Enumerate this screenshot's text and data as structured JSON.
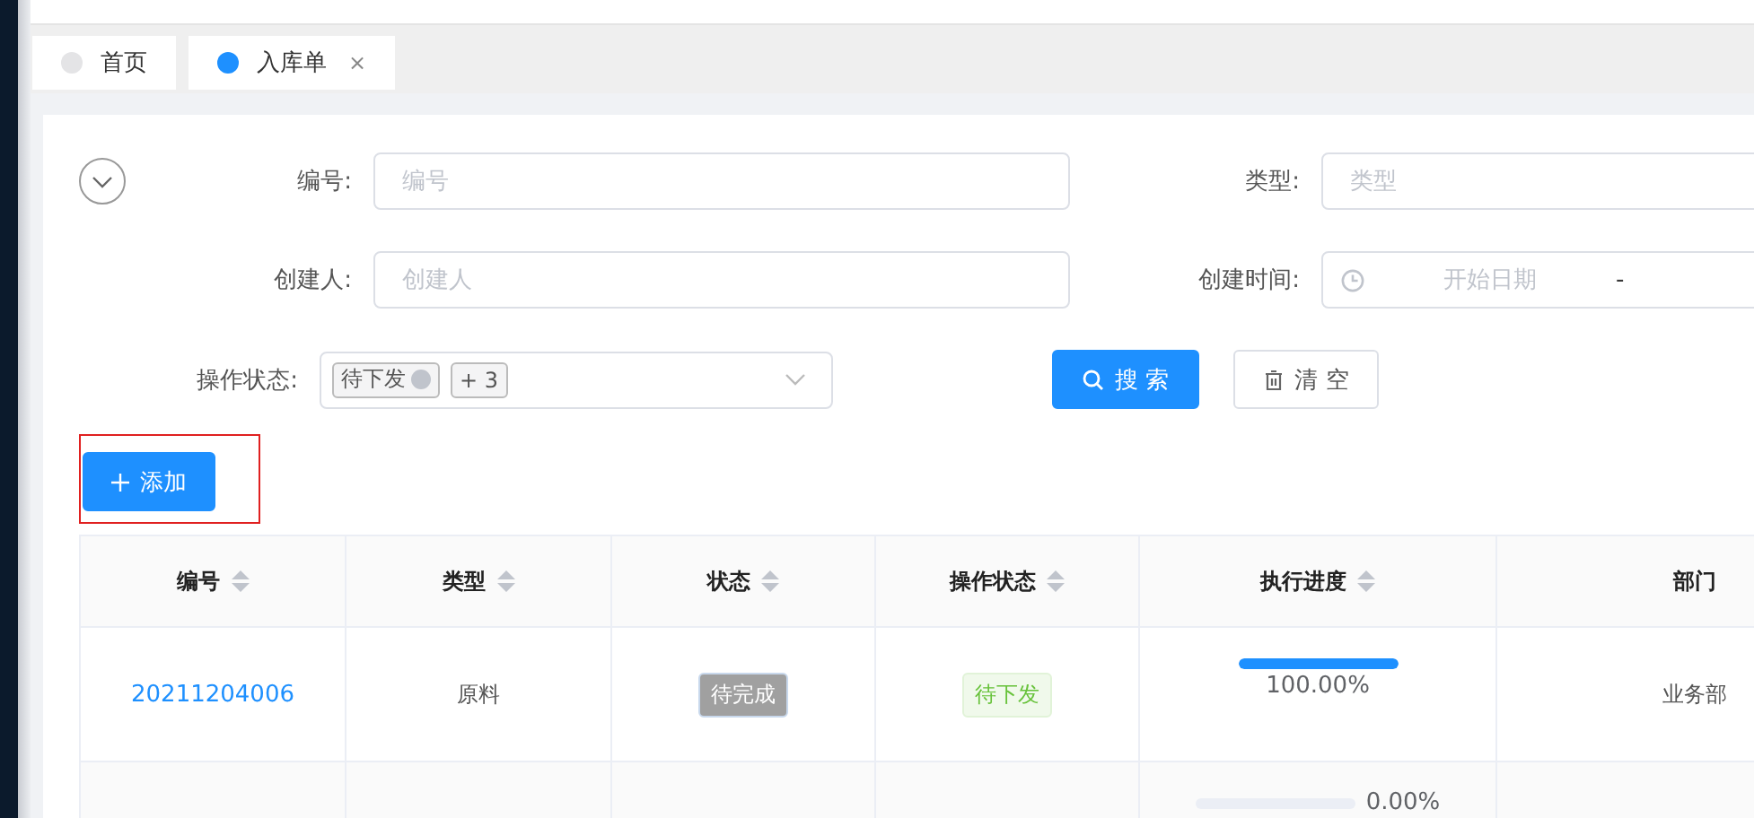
{
  "tabs": [
    {
      "label": "首页",
      "selected": false
    },
    {
      "label": "入库单",
      "selected": true,
      "close_icon": "×"
    }
  ],
  "filters": [
    {
      "kind": "text",
      "label": "编号:",
      "placeholder": "编号"
    },
    {
      "kind": "text",
      "label": "类型:",
      "placeholder": "类型"
    },
    {
      "kind": "text",
      "label": "创建人:",
      "placeholder": "创建人"
    },
    {
      "kind": "daterange",
      "label": "创建时间:",
      "start_placeholder": "开始日期",
      "separator": "-"
    }
  ],
  "status_filter": {
    "label": "操作状态:",
    "tags": [
      {
        "text": "待下发",
        "removable": true
      },
      {
        "text": "+ 3",
        "removable": false
      }
    ]
  },
  "search_button": "搜 索",
  "clear_button": "清 空",
  "add_button": "添加",
  "table": {
    "columns": [
      {
        "title": "编号",
        "sortable": true
      },
      {
        "title": "类型",
        "sortable": true
      },
      {
        "title": "状态",
        "sortable": true
      },
      {
        "title": "操作状态",
        "sortable": true
      },
      {
        "title": "执行进度",
        "sortable": true
      },
      {
        "title": "部门",
        "sortable": false
      }
    ],
    "rows": [
      {
        "id": "20211204006",
        "type": "原料",
        "status": "待完成",
        "operation_status": "待下发",
        "progress": {
          "level": 1,
          "reading": "100.00%",
          "kind": "stacked"
        },
        "department": "业务部"
      },
      {
        "progress": {
          "level": 0,
          "reading": "0.00%",
          "kind": "inline"
        }
      }
    ]
  }
}
